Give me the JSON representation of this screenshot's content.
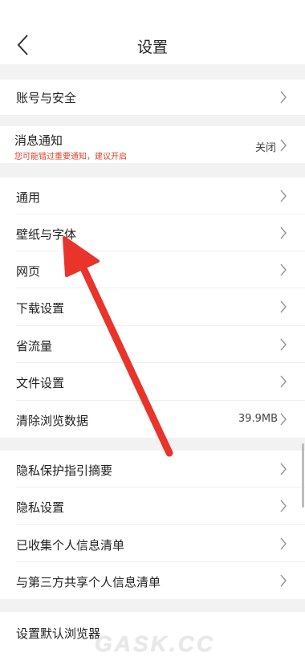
{
  "header": {
    "title": "设置"
  },
  "sections": {
    "account": {
      "label": "账号与安全"
    },
    "notify": {
      "label": "消息通知",
      "hint": "您可能错过重要通知，建议开启",
      "value": "关闭"
    },
    "general": [
      {
        "label": "通用"
      },
      {
        "label": "壁纸与字体"
      },
      {
        "label": "网页"
      },
      {
        "label": "下载设置"
      },
      {
        "label": "省流量"
      },
      {
        "label": "文件设置"
      },
      {
        "label": "清除浏览数据",
        "value": "39.9MB"
      }
    ],
    "privacy": [
      {
        "label": "隐私保护指引摘要"
      },
      {
        "label": "隐私设置"
      },
      {
        "label": "已收集个人信息清单"
      },
      {
        "label": "与第三方共享个人信息清单"
      }
    ],
    "browser": {
      "label": "设置默认浏览器"
    }
  },
  "watermark": "GASK.CC",
  "accent_color": "#e8342b"
}
